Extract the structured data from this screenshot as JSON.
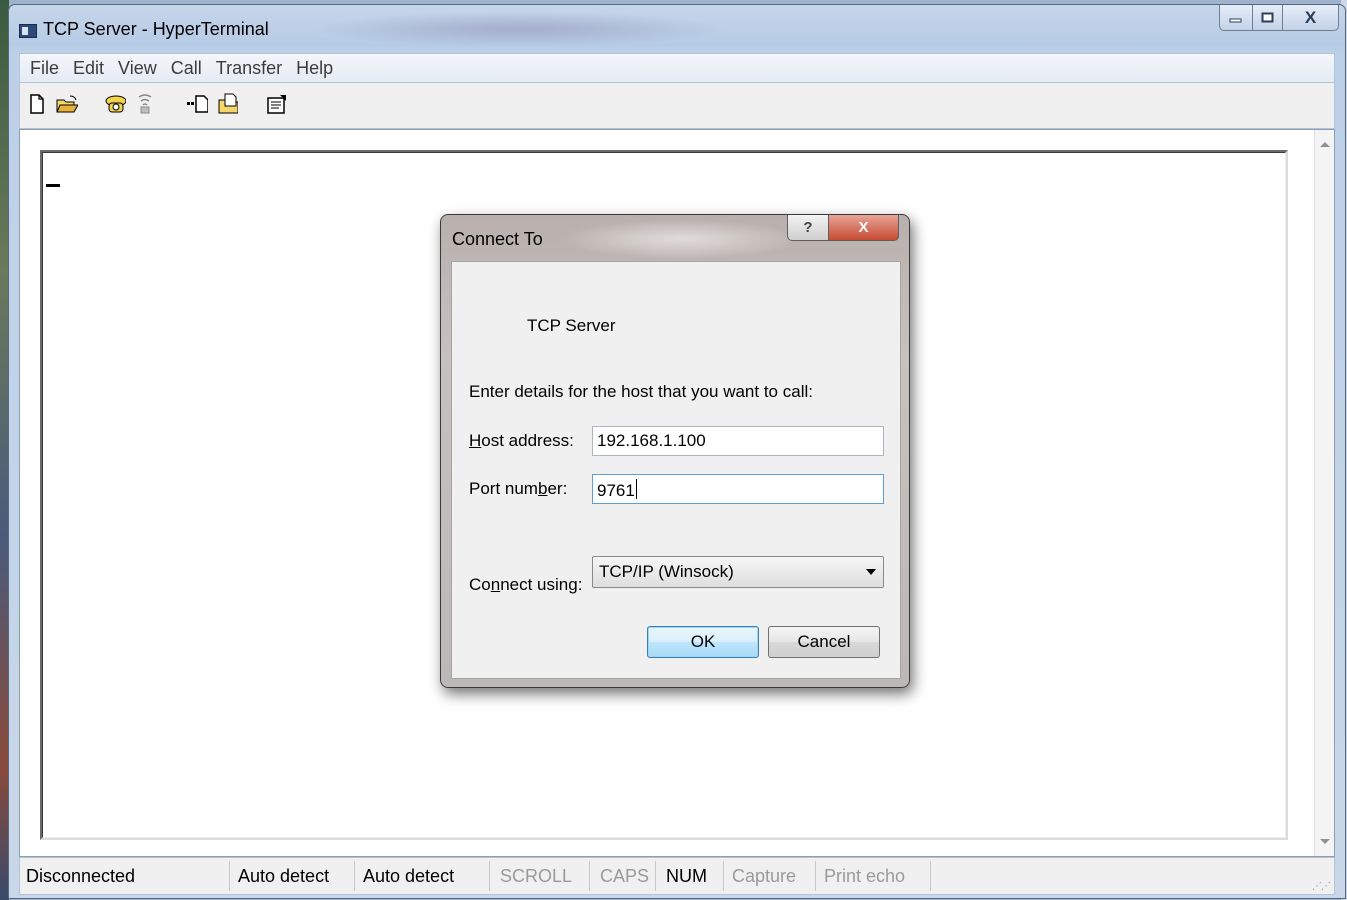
{
  "window": {
    "title": "TCP Server - HyperTerminal",
    "controls": {
      "minimize": "—",
      "maximize": "□",
      "close": "X"
    }
  },
  "menu": [
    "File",
    "Edit",
    "View",
    "Call",
    "Transfer",
    "Help"
  ],
  "toolbar": [
    "new-document-icon",
    "open-folder-icon",
    "phone-call-icon",
    "hang-up-icon",
    "send-file-icon",
    "receive-file-icon",
    "properties-icon"
  ],
  "status": {
    "connection": "Disconnected",
    "detect1": "Auto detect",
    "detect2": "Auto detect",
    "scroll": "SCROLL",
    "caps": "CAPS",
    "num": "NUM",
    "capture": "Capture",
    "print_echo": "Print echo"
  },
  "dialog": {
    "title": "Connect To",
    "help_symbol": "?",
    "close_symbol": "X",
    "connection_name": "TCP Server",
    "prompt": "Enter details for the host that you want to call:",
    "host_label_pre": "",
    "host_label_u": "H",
    "host_label_post": "ost address:",
    "host_value": "192.168.1.100",
    "port_label_pre": "Port num",
    "port_label_u": "b",
    "port_label_post": "er:",
    "port_value": "9761",
    "connect_label_pre": "Co",
    "connect_label_u": "n",
    "connect_label_post": "nect using:",
    "connect_value": "TCP/IP (Winsock)",
    "ok": "OK",
    "cancel": "Cancel"
  },
  "colors": {
    "title_bar": "#b6cbe5",
    "dialog_close": "#c64a33",
    "ok_button": "#bee6fd"
  }
}
